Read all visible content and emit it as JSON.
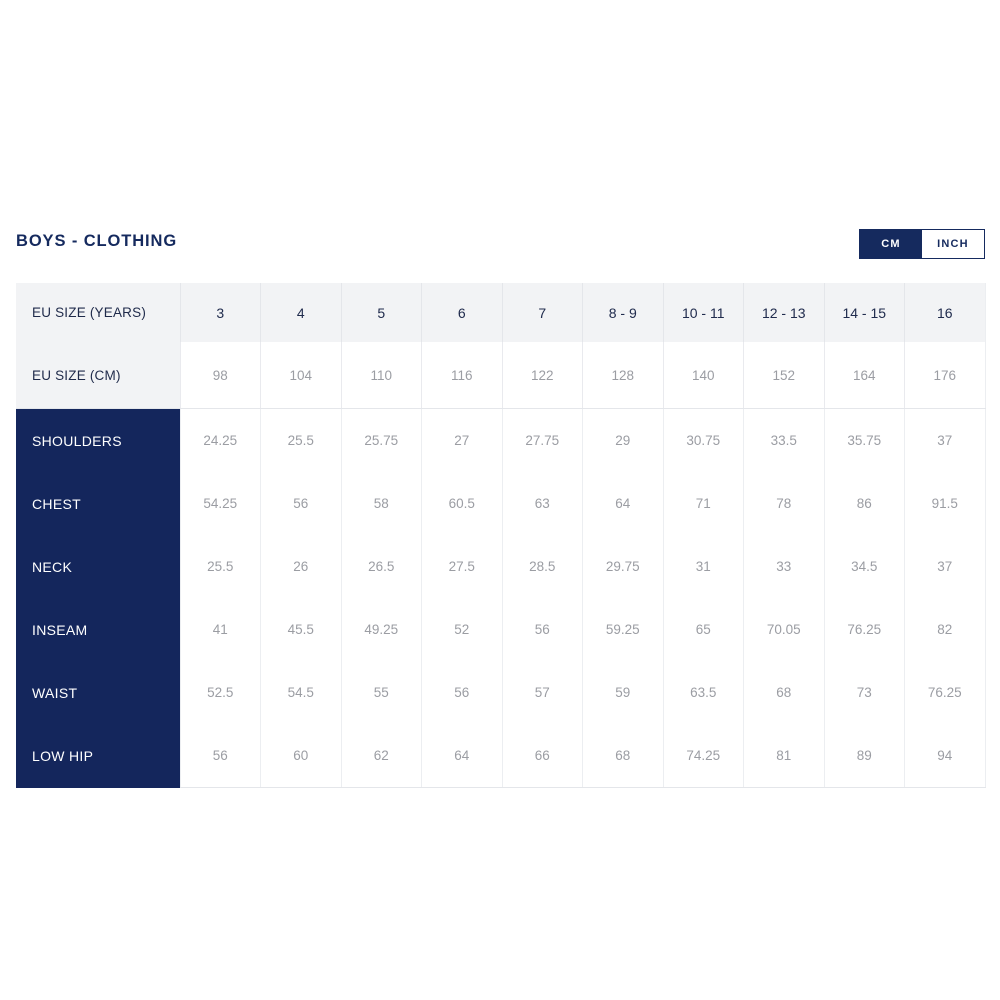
{
  "chart": {
    "title": "BOYS - CLOTHING",
    "unit_toggle": {
      "active": "cm",
      "options": [
        {
          "id": "cm",
          "label": "CM",
          "active": true
        },
        {
          "id": "inch",
          "label": "INCH",
          "active": false
        }
      ]
    },
    "colors": {
      "navy": "#14265c",
      "title_navy": "#152a5e",
      "header_gray": "#f2f3f5",
      "value_gray": "#9b9da3",
      "border": "#e4e6ea"
    }
  },
  "chart_data": {
    "type": "table",
    "title": "BOYS - CLOTHING",
    "unit": "CM",
    "header_rows": [
      {
        "label": "EU SIZE (YEARS)",
        "values": [
          "3",
          "4",
          "5",
          "6",
          "7",
          "8 - 9",
          "10 - 11",
          "12 - 13",
          "14 - 15",
          "16"
        ]
      },
      {
        "label": "EU SIZE (CM)",
        "values": [
          "98",
          "104",
          "110",
          "116",
          "122",
          "128",
          "140",
          "152",
          "164",
          "176"
        ]
      }
    ],
    "categories": [
      "3",
      "4",
      "5",
      "6",
      "7",
      "8 - 9",
      "10 - 11",
      "12 - 13",
      "14 - 15",
      "16"
    ],
    "rows": [
      {
        "label": "SHOULDERS",
        "values": [
          "24.25",
          "25.5",
          "25.75",
          "27",
          "27.75",
          "29",
          "30.75",
          "33.5",
          "35.75",
          "37"
        ]
      },
      {
        "label": "CHEST",
        "values": [
          "54.25",
          "56",
          "58",
          "60.5",
          "63",
          "64",
          "71",
          "78",
          "86",
          "91.5"
        ]
      },
      {
        "label": "NECK",
        "values": [
          "25.5",
          "26",
          "26.5",
          "27.5",
          "28.5",
          "29.75",
          "31",
          "33",
          "34.5",
          "37"
        ]
      },
      {
        "label": "INSEAM",
        "values": [
          "41",
          "45.5",
          "49.25",
          "52",
          "56",
          "59.25",
          "65",
          "70.05",
          "76.25",
          "82"
        ]
      },
      {
        "label": "WAIST",
        "values": [
          "52.5",
          "54.5",
          "55",
          "56",
          "57",
          "59",
          "63.5",
          "68",
          "73",
          "76.25"
        ]
      },
      {
        "label": "LOW HIP",
        "values": [
          "56",
          "60",
          "62",
          "64",
          "66",
          "68",
          "74.25",
          "81",
          "89",
          "94"
        ]
      }
    ]
  }
}
